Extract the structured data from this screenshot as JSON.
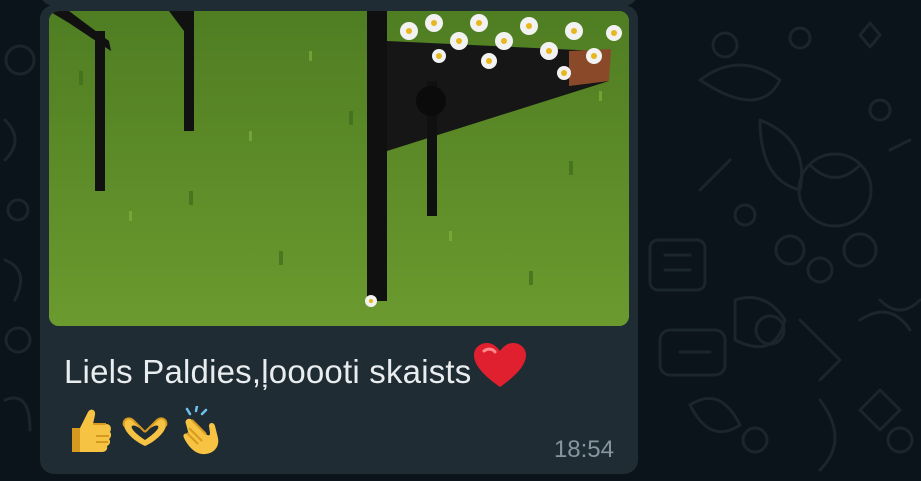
{
  "message": {
    "caption": "Liels Paldies,ļooooti skaists",
    "emojis": [
      {
        "name": "thumbs-up-icon"
      },
      {
        "name": "heart-hands-icon"
      },
      {
        "name": "clapping-hands-icon"
      }
    ],
    "time": "18:54",
    "image": {
      "alt_icon": "photo-icon"
    }
  },
  "colors": {
    "background": "#0b141a",
    "bubble": "#1f2c34",
    "text": "#e9edef",
    "meta": "#8696a0",
    "heart": "#e0202f"
  }
}
